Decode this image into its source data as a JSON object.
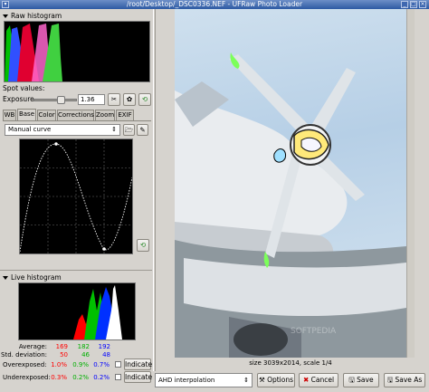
{
  "window": {
    "title": "/root/Desktop/_DSC0336.NEF - UFRaw Photo Loader"
  },
  "raw_histogram": {
    "label": "Raw histogram"
  },
  "spot_values": {
    "label": "Spot values:"
  },
  "exposure": {
    "label": "Exposure",
    "value": "1.36",
    "slider_fraction": 0.62
  },
  "tabs": [
    {
      "label": "WB"
    },
    {
      "label": "Base"
    },
    {
      "label": "Color"
    },
    {
      "label": "Corrections"
    },
    {
      "label": "Zoom"
    },
    {
      "label": "EXIF"
    }
  ],
  "curve": {
    "selected": "Manual curve"
  },
  "live_histogram": {
    "label": "Live histogram"
  },
  "stats": {
    "average_label": "Average:",
    "std_label": "Std. deviation:",
    "average": [
      "169",
      "182",
      "192"
    ],
    "std": [
      "50",
      "46",
      "48"
    ],
    "overexposed_label": "Overexposed:",
    "overexposed": [
      "1.0%",
      "0.9%",
      "0.7%"
    ],
    "underexposed_label": "Underexposed:",
    "underexposed": [
      "0.3%",
      "0.2%",
      "0.2%"
    ],
    "indicate_label": "Indicate"
  },
  "colors": {
    "red": "#ff0000",
    "green": "#00b000",
    "blue": "#0000ff"
  },
  "preview": {
    "status": "size 3039x2014, scale 1/4",
    "watermark": "SOFTPEDIA"
  },
  "bottom": {
    "interpolation": "AHD interpolation",
    "options": "Options",
    "cancel": "Cancel",
    "save": "Save",
    "save_as": "Save As"
  }
}
